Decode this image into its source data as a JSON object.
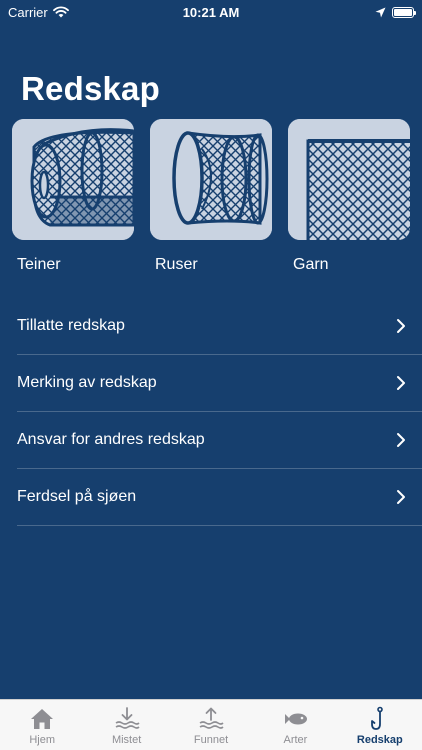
{
  "status_bar": {
    "carrier": "Carrier",
    "time": "10:21 AM",
    "icons": [
      "wifi-icon",
      "location-arrow-icon",
      "battery-icon"
    ]
  },
  "page": {
    "title": "Redskap"
  },
  "categories": [
    {
      "label": "Teiner",
      "icon": "fish-trap-illustration"
    },
    {
      "label": "Ruser",
      "icon": "fyke-net-illustration"
    },
    {
      "label": "Garn",
      "icon": "gill-net-illustration"
    }
  ],
  "menu": [
    {
      "label": "Tillatte redskap"
    },
    {
      "label": "Merking av redskap"
    },
    {
      "label": "Ansvar for andres redskap"
    },
    {
      "label": "Ferdsel på sjøen"
    }
  ],
  "tab_bar": {
    "tabs": [
      {
        "label": "Hjem",
        "icon": "home-icon",
        "active": false
      },
      {
        "label": "Mistet",
        "icon": "lost-download-waves-icon",
        "active": false
      },
      {
        "label": "Funnet",
        "icon": "found-upload-waves-icon",
        "active": false
      },
      {
        "label": "Arter",
        "icon": "fish-icon",
        "active": false
      },
      {
        "label": "Redskap",
        "icon": "fishhook-icon",
        "active": true
      }
    ]
  },
  "colors": {
    "background": "#163f6e",
    "card_background": "#c9d3e1",
    "tab_active": "#163f6e",
    "tab_inactive": "#8e8e93"
  }
}
